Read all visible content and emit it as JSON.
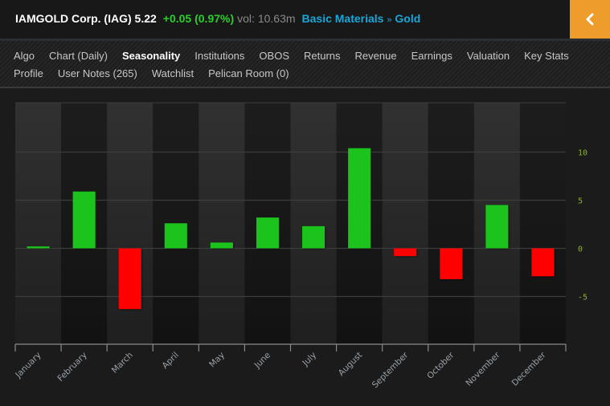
{
  "header": {
    "title": "IAMGOLD Corp. (IAG) 5.22",
    "change": "+0.05 (0.97%)",
    "volume": "vol: 10.63m",
    "sector": "Basic Materials",
    "separator": "»",
    "industry": "Gold",
    "back_icon": "chevron-left-icon"
  },
  "nav": {
    "row1": [
      "Algo",
      "Chart (Daily)",
      "Seasonality",
      "Institutions",
      "OBOS",
      "Returns",
      "Revenue",
      "Earnings",
      "Valuation",
      "Key Stats"
    ],
    "row2": [
      "Profile",
      "User Notes (265)",
      "Watchlist",
      "Pelican Room (0)"
    ],
    "active": "Seasonality"
  },
  "colors": {
    "positive": "#1ac31a",
    "negative": "#ff0000",
    "accent": "#ee9c2c",
    "link": "#1aa6d9",
    "ytick": "#8bb03a"
  },
  "chart_data": {
    "type": "bar",
    "title": "",
    "xlabel": "",
    "ylabel": "",
    "categories": [
      "January",
      "February",
      "March",
      "April",
      "May",
      "June",
      "July",
      "August",
      "September",
      "October",
      "November",
      "December"
    ],
    "values": [
      0.2,
      5.9,
      -6.3,
      2.6,
      0.6,
      3.2,
      2.3,
      10.4,
      -0.8,
      -3.2,
      4.5,
      -2.9
    ],
    "ylim": [
      -10,
      15
    ],
    "yticks": [
      10,
      5,
      0,
      -5
    ],
    "ytick_labels": [
      "10",
      "5",
      "0",
      "-5"
    ],
    "y_axis_side": "right",
    "grid": true,
    "legend": "none"
  }
}
